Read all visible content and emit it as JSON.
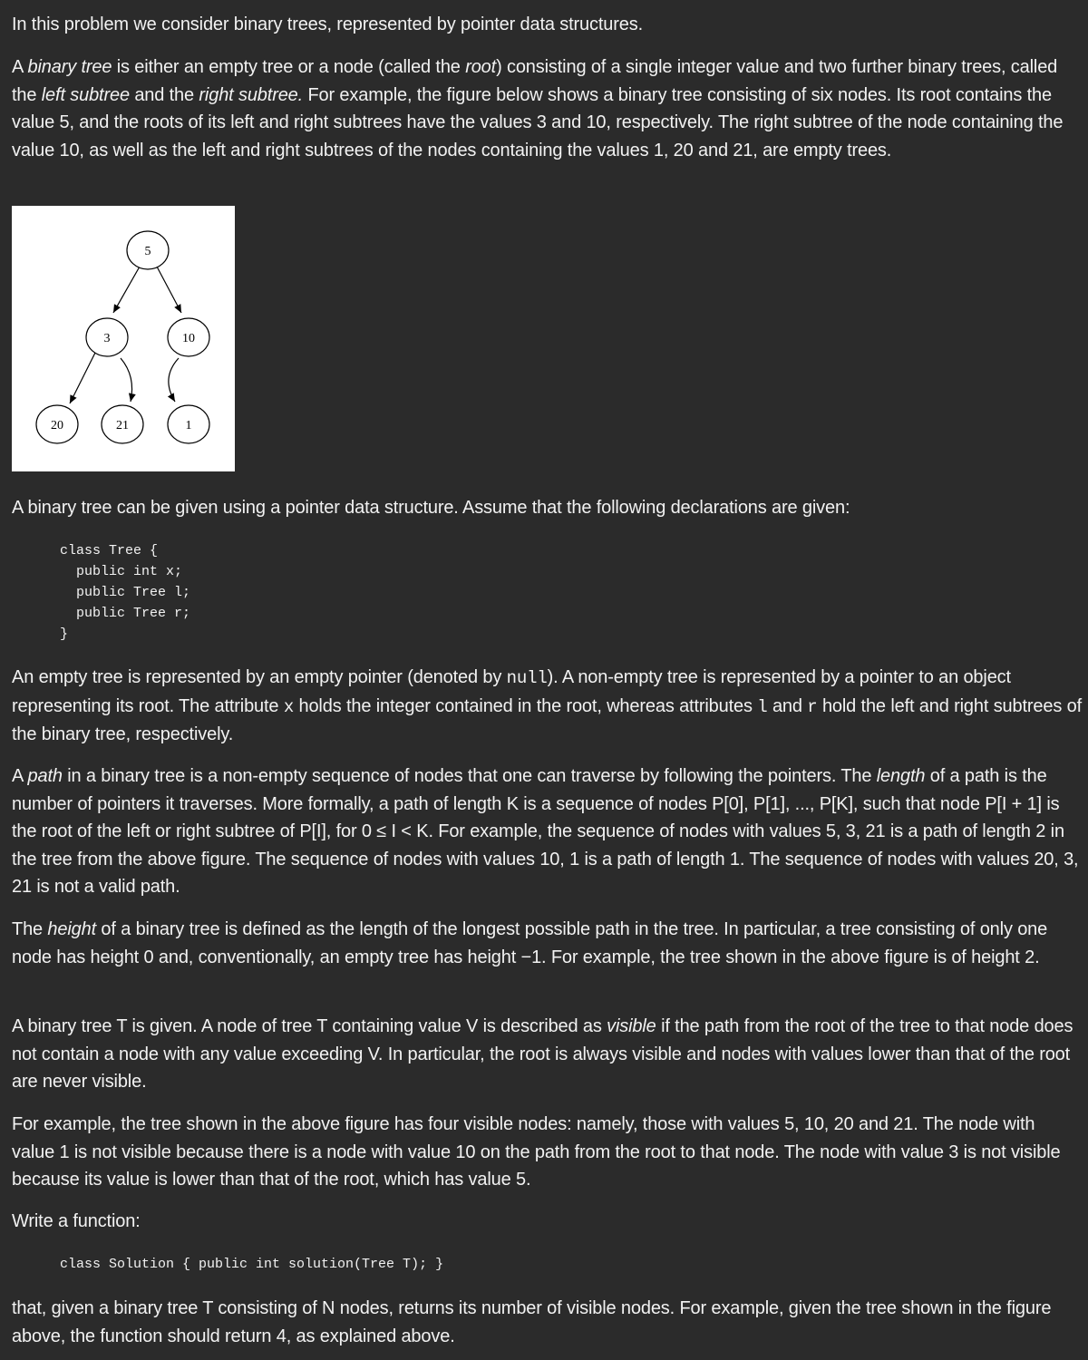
{
  "paragraphs": {
    "intro": "In this problem we consider binary trees, represented by pointer data structures.",
    "def_a": "A ",
    "def_binary_tree": "binary tree",
    "def_b": " is either an empty tree or a node (called the ",
    "def_root": "root",
    "def_c": ") consisting of a single integer value and two further binary trees, called the ",
    "def_left": "left subtree",
    "def_d": " and the ",
    "def_right": "right subtree.",
    "def_e": " For example, the figure below shows a binary tree consisting of six nodes. Its root contains the value 5, and the roots of its left and right subtrees have the values 3 and 10, respectively. The right subtree of the node containing the value 10, as well as the left and right subtrees of the nodes containing the values 1, 20 and 21, are empty trees.",
    "pointer_intro": "A binary tree can be given using a pointer data structure. Assume that the following declarations are given:",
    "empty_a": "An empty tree is represented by an empty pointer (denoted by ",
    "empty_null": "null",
    "empty_b": "). A non-empty tree is represented by a pointer to an object representing its root. The attribute ",
    "empty_x": "x",
    "empty_c": " holds the integer contained in the root, whereas attributes ",
    "empty_l": "l",
    "empty_d": " and ",
    "empty_r": "r",
    "empty_e": " hold the left and right subtrees of the binary tree, respectively.",
    "path_a": "A ",
    "path_word": "path",
    "path_b": " in a binary tree is a non-empty sequence of nodes that one can traverse by following the pointers. The ",
    "path_length": "length",
    "path_c": " of a path is the number of pointers it traverses. More formally, a path of length K is a sequence of nodes P[0], P[1], ..., P[K], such that node P[I + 1] is the root of the left or right subtree of P[I], for 0 ≤ I < K. For example, the sequence of nodes with values 5, 3, 21 is a path of length 2 in the tree from the above figure. The sequence of nodes with values 10, 1 is a path of length 1. The sequence of nodes with values 20, 3, 21 is not a valid path.",
    "height_a": "The ",
    "height_word": "height",
    "height_b": " of a binary tree is defined as the length of the longest possible path in the tree. In particular, a tree consisting of only one node has height 0 and, conventionally, an empty tree has height −1. For example, the tree shown in the above figure is of height 2.",
    "visible_a": "A binary tree T is given. A node of tree T containing value V is described as ",
    "visible_word": "visible",
    "visible_b": " if the path from the root of the tree to that node does not contain a node with any value exceeding V. In particular, the root is always visible and nodes with values lower than that of the root are never visible.",
    "example": "For example, the tree shown in the above figure has four visible nodes: namely, those with values 5, 10, 20 and 21. The node with value 1 is not visible because there is a node with value 10 on the path from the root to that node. The node with value 3 is not visible because its value is lower than that of the root, which has value 5.",
    "write": "Write a function:",
    "final": "that, given a binary tree T consisting of N nodes, returns its number of visible nodes. For example, given the tree shown in the figure above, the function should return 4, as explained above."
  },
  "code": {
    "declarations": "class Tree {\n  public int x;\n  public Tree l;\n  public Tree r;\n}",
    "solution": "class Solution { public int solution(Tree T); }"
  },
  "tree": {
    "nodes": [
      {
        "id": "n5",
        "label": "5"
      },
      {
        "id": "n3",
        "label": "3"
      },
      {
        "id": "n10",
        "label": "10"
      },
      {
        "id": "n20",
        "label": "20"
      },
      {
        "id": "n21",
        "label": "21"
      },
      {
        "id": "n1",
        "label": "1"
      }
    ]
  }
}
